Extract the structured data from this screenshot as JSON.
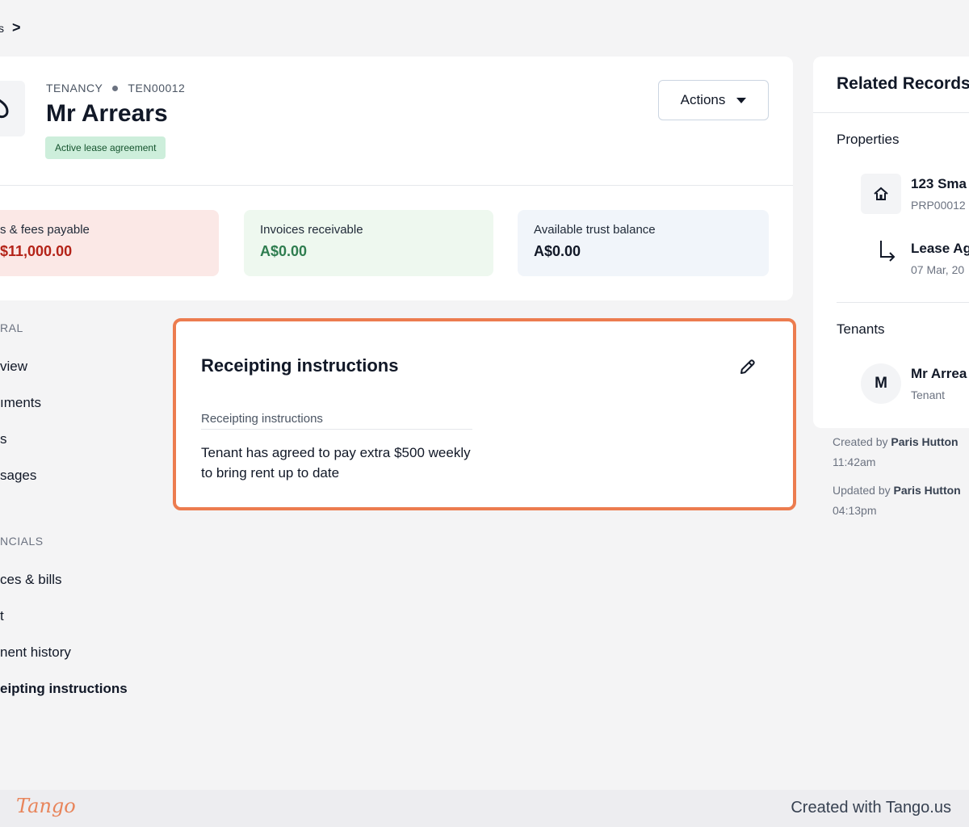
{
  "breadcrumb": {
    "crumb": "s",
    "separator": ">"
  },
  "header": {
    "type": "TENANCY",
    "reference": "TEN00012",
    "title": "Mr Arrears",
    "status_badge": "Active lease agreement",
    "actions_label": "Actions"
  },
  "stats": [
    {
      "label": "s & fees payable",
      "value": "$11,000.00"
    },
    {
      "label": "Invoices receivable",
      "value": "A$0.00"
    },
    {
      "label": "Available trust balance",
      "value": "A$0.00"
    }
  ],
  "sidenav": {
    "general_heading": "RAL",
    "general_items": [
      "view",
      "ıments",
      "s",
      "sages"
    ],
    "financials_heading": "NCIALS",
    "financial_items": [
      "ces & bills",
      "t",
      "nent history",
      "eipting instructions"
    ]
  },
  "panel": {
    "title": "Receipting instructions",
    "field_label": "Receipting instructions",
    "field_value": "Tenant has agreed to pay extra $500 weekly to bring rent up to date"
  },
  "related": {
    "title": "Related Records",
    "properties_heading": "Properties",
    "property_title": "123 Sma",
    "property_ref": "PRP00012",
    "lease_title": "Lease Ag",
    "lease_date": "07 Mar, 20",
    "tenants_heading": "Tenants",
    "tenant_initial": "M",
    "tenant_name": "Mr Arrea",
    "tenant_role": "Tenant"
  },
  "audit": {
    "created_prefix": "Created by",
    "created_by": "Paris Hutton",
    "created_time": "11:42am",
    "updated_prefix": "Updated by",
    "updated_by": "Paris Hutton",
    "updated_time": "04:13pm"
  },
  "footer": {
    "logo": "Tango",
    "text": "Created with Tango.us"
  },
  "colors": {
    "accent_highlight": "#ec7c4f",
    "payable": "#b42318",
    "receivable": "#2e7d4f"
  }
}
